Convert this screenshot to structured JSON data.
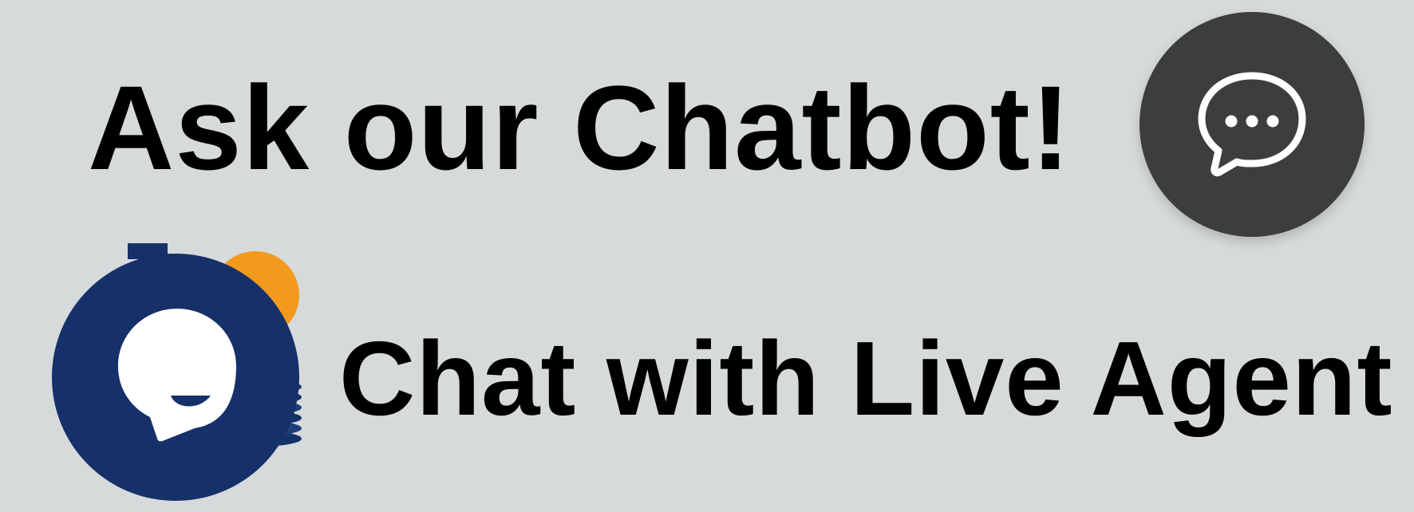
{
  "chatbot": {
    "heading": "Ask our Chatbot!",
    "icon": "speech-bubble-ellipsis-icon",
    "button_color": "#3d3d3d"
  },
  "live_agent": {
    "heading": "Chat with Live Agent",
    "icon": "smiling-speech-bubble-icon",
    "button_color": "#16306a",
    "accent_color": "#f39a1c"
  },
  "page": {
    "background": "#d7dadb"
  }
}
